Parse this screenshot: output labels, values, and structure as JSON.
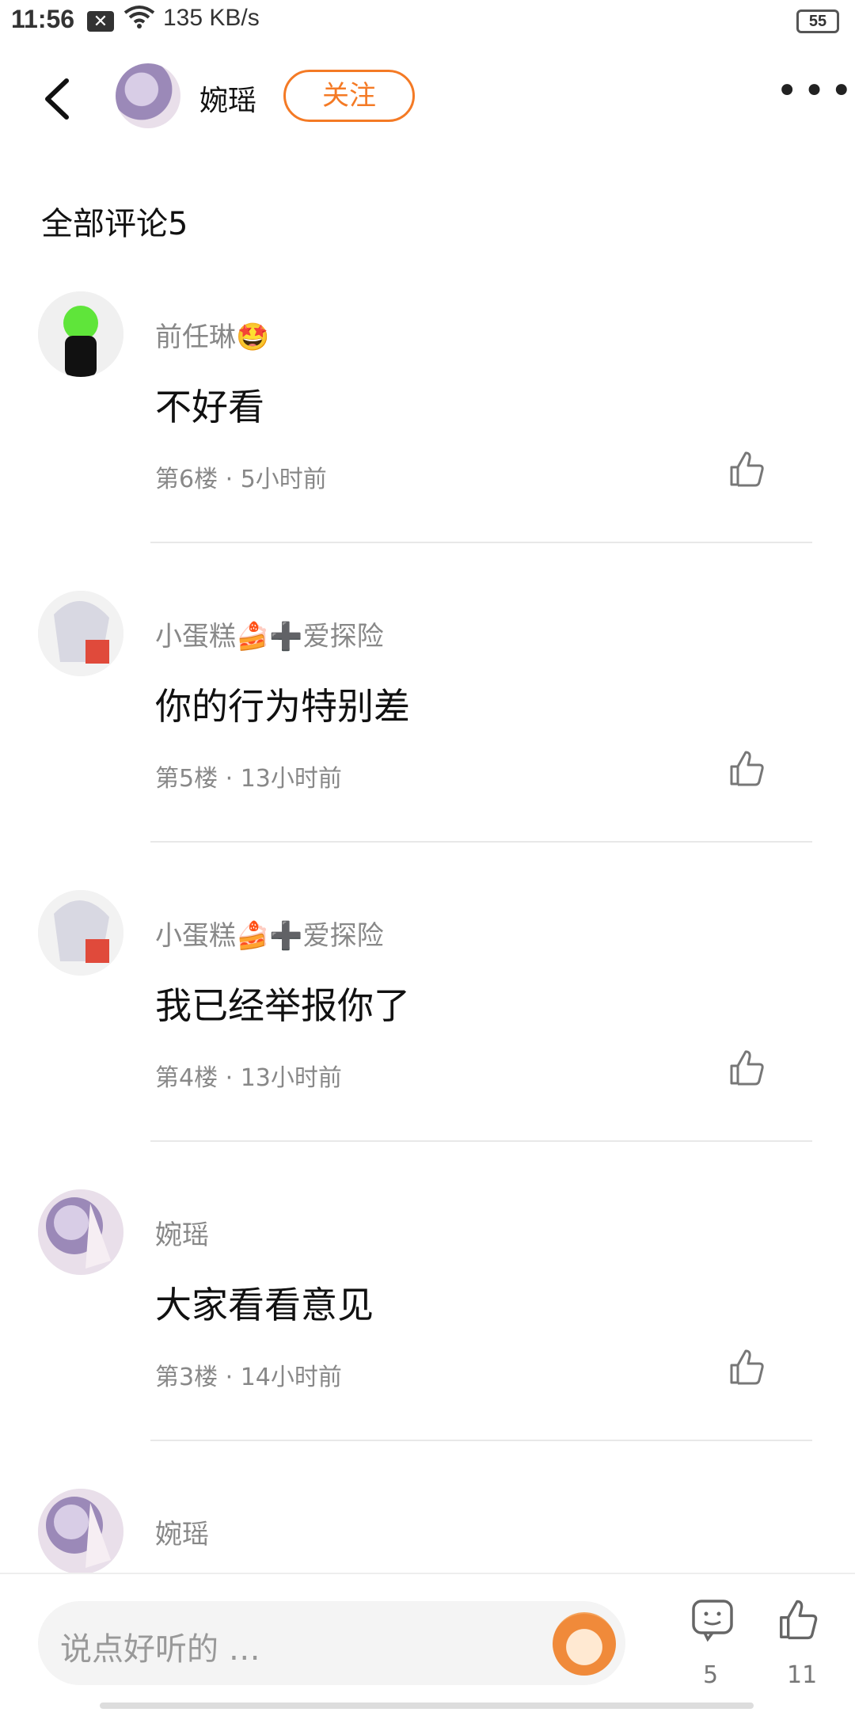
{
  "status_bar": {
    "time": "11:56",
    "network_speed": "135 KB/s",
    "battery": "55"
  },
  "header": {
    "username": "婉瑶",
    "follow_label": "关注",
    "more_label": "•••"
  },
  "section_title": "全部评论5",
  "comments": [
    {
      "name": "前任琳🤩",
      "text": "不好看",
      "meta": "第6楼 · 5小时前",
      "avatar": "green-hair-avatar"
    },
    {
      "name": "小蛋糕🍰➕爱探险",
      "text": "你的行为特别差",
      "meta": "第5楼 · 13小时前",
      "avatar": "white-hair-avatar"
    },
    {
      "name": "小蛋糕🍰➕爱探险",
      "text": "我已经举报你了",
      "meta": "第4楼 · 13小时前",
      "avatar": "white-hair-avatar"
    },
    {
      "name": "婉瑶",
      "text": "大家看看意见",
      "meta": "第3楼 · 14小时前",
      "avatar": "purple-hair-avatar"
    },
    {
      "name": "婉瑶",
      "text": "",
      "meta": "",
      "avatar": "purple-hair-avatar"
    }
  ],
  "bottom_bar": {
    "input_placeholder": "说点好听的 …",
    "comment_count": "5",
    "like_count": "11"
  },
  "colors": {
    "accent": "#f47a25",
    "secondary_text": "#888888"
  }
}
